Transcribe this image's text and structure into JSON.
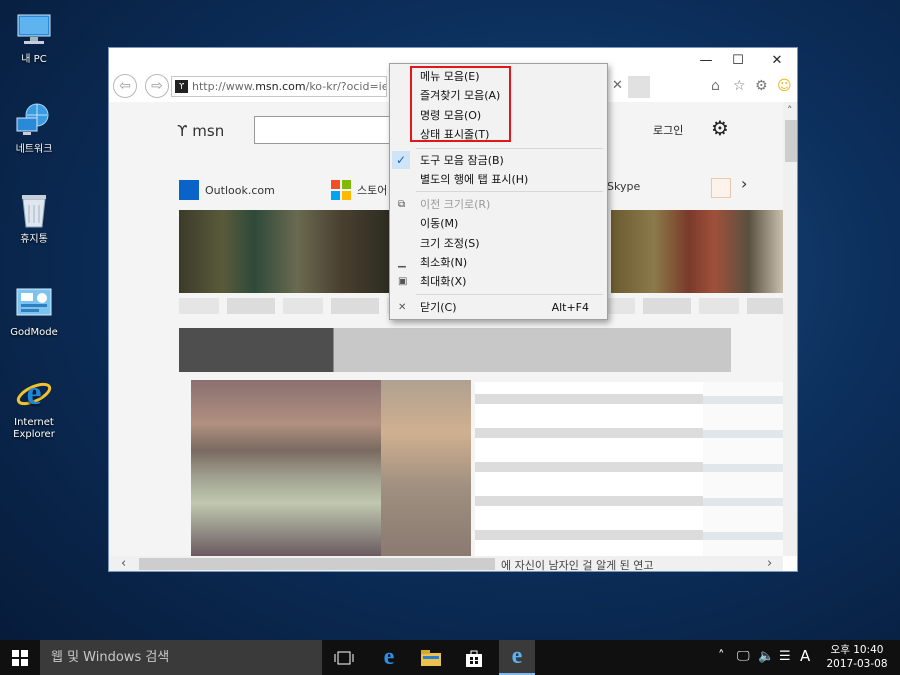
{
  "desktop_icons": [
    {
      "label": "내 PC",
      "icon": "computer-icon"
    },
    {
      "label": "네트워크",
      "icon": "network-icon"
    },
    {
      "label": "휴지통",
      "icon": "recycle-bin-icon"
    },
    {
      "label": "GodMode",
      "icon": "control-panel-icon"
    },
    {
      "label": "Internet Explorer",
      "icon": "internet-explorer-icon"
    }
  ],
  "window": {
    "minimize_glyph": "—",
    "maximize_glyph": "☐",
    "close_glyph": "✕",
    "address_prefix": "http://www.",
    "address_domain": "msn.com",
    "address_suffix": "/ko-kr/?ocid=iehp",
    "tab_close_glyph": "✕"
  },
  "page": {
    "logo_text": "msn",
    "login_label": "로그인",
    "quick_links": [
      "Outlook.com",
      "스토어",
      "Skype"
    ],
    "headline_fragment": "에 자신이 남자인 걸 알게 된 연고"
  },
  "context_menu": {
    "items": [
      {
        "label": "메뉴 모음(E)"
      },
      {
        "label": "즐겨찾기 모음(A)"
      },
      {
        "label": "명령 모음(O)"
      },
      {
        "label": "상태 표시줄(T)"
      },
      {
        "label": "도구 모음 잠금(B)",
        "checked": true
      },
      {
        "label": "별도의 행에 탭 표시(H)"
      },
      {
        "label": "이전 크기로(R)",
        "disabled": true
      },
      {
        "label": "이동(M)"
      },
      {
        "label": "크기 조정(S)"
      },
      {
        "label": "최소화(N)"
      },
      {
        "label": "최대화(X)"
      },
      {
        "label": "닫기(C)",
        "accelerator": "Alt+F4"
      }
    ]
  },
  "taskbar": {
    "search_placeholder": "웹 및 Windows 검색",
    "ime_label": "A",
    "time": "오후 10:40",
    "date": "2017-03-08"
  },
  "colors": {
    "highlight_box": "#e01818",
    "accent_ie": "#1e88d8",
    "taskbar": "#101010"
  }
}
